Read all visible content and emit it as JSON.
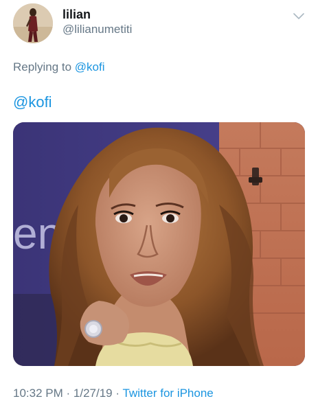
{
  "author": {
    "display_name": "lilian",
    "handle": "@lilianumetiti"
  },
  "reply": {
    "prefix": "Replying to",
    "mention": "@kofi"
  },
  "tweet": {
    "text": "@kofi",
    "media": {
      "overlay_text": "en"
    }
  },
  "meta": {
    "time": "10:32 PM",
    "separator": "·",
    "date": "1/27/19",
    "source": "Twitter for iPhone"
  },
  "icons": {
    "menu": "chevron-down-icon"
  },
  "colors": {
    "link": "#1b95e0",
    "secondary_text": "#657786",
    "primary_text": "#14171a"
  }
}
